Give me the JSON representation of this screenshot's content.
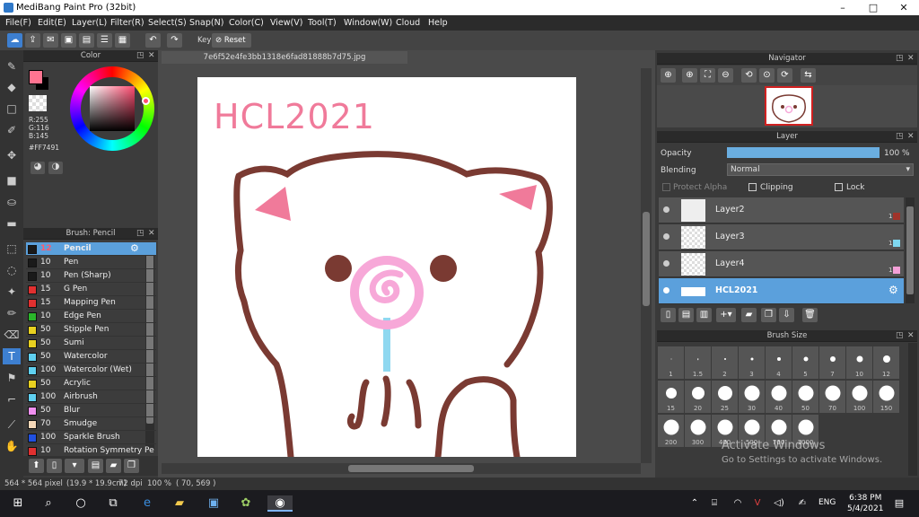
{
  "app": {
    "title": "MediBang Paint Pro (32bit)"
  },
  "window_controls": {
    "minimize": "–",
    "maximize": "□",
    "close": "✕"
  },
  "menu": [
    "File(F)",
    "Edit(E)",
    "Layer(L)",
    "Filter(R)",
    "Select(S)",
    "Snap(N)",
    "Color(C)",
    "View(V)",
    "Tool(T)",
    "Window(W)",
    "Cloud",
    "Help"
  ],
  "toolbar": {
    "key_label": "Key",
    "reset_label": "Reset"
  },
  "color_panel": {
    "title": "Color",
    "r": "R:255",
    "g": "G:116",
    "b": "B:145",
    "hex": "#FF7491",
    "primary": "#FF7491"
  },
  "brush_panel": {
    "title": "Brush: Pencil",
    "items": [
      {
        "size": "12",
        "name": "Pencil",
        "color": "#1a1a1a",
        "selected": true
      },
      {
        "size": "10",
        "name": "Pen",
        "color": "#1a1a1a"
      },
      {
        "size": "10",
        "name": "Pen (Sharp)",
        "color": "#1a1a1a"
      },
      {
        "size": "15",
        "name": "G Pen",
        "color": "#e03030"
      },
      {
        "size": "15",
        "name": "Mapping Pen",
        "color": "#e03030"
      },
      {
        "size": "10",
        "name": "Edge Pen",
        "color": "#2ab52a"
      },
      {
        "size": "50",
        "name": "Stipple Pen",
        "color": "#e8d020"
      },
      {
        "size": "50",
        "name": "Sumi",
        "color": "#e8d020"
      },
      {
        "size": "50",
        "name": "Watercolor",
        "color": "#5fd0f0"
      },
      {
        "size": "100",
        "name": "Watercolor (Wet)",
        "color": "#5fd0f0"
      },
      {
        "size": "50",
        "name": "Acrylic",
        "color": "#e8d020"
      },
      {
        "size": "100",
        "name": "Airbrush",
        "color": "#5fd0f0"
      },
      {
        "size": "50",
        "name": "Blur",
        "color": "#f090f0"
      },
      {
        "size": "70",
        "name": "Smudge",
        "color": "#f5d8b8"
      },
      {
        "size": "100",
        "name": "Sparkle Brush",
        "color": "#2050e0"
      },
      {
        "size": "10",
        "name": "Rotation Symmetry Pe",
        "color": "#e03030"
      }
    ]
  },
  "document": {
    "tab": "7e6f52e4fe3bb1318e6fad81888b7d75.jpg",
    "canvas_text": "HCL2021"
  },
  "navigator": {
    "title": "Navigator"
  },
  "layer_panel": {
    "title": "Layer",
    "opacity_label": "Opacity",
    "opacity_value": "100 %",
    "opacity_fraction": 1.0,
    "blending_label": "Blending",
    "blending_value": "Normal",
    "protect_alpha": "Protect Alpha",
    "clipping": "Clipping",
    "lock": "Lock",
    "layers": [
      {
        "name": "Layer2",
        "badge": "1",
        "badge_color": "#a0332a"
      },
      {
        "name": "Layer3",
        "badge": "1",
        "badge_color": "#7fd8f0"
      },
      {
        "name": "Layer4",
        "badge": "1",
        "badge_color": "#f4a0d8"
      },
      {
        "name": "HCL2021",
        "selected": true
      }
    ]
  },
  "brush_size": {
    "title": "Brush Size",
    "sizes": [
      "1",
      "1.5",
      "2",
      "3",
      "4",
      "5",
      "7",
      "10",
      "12",
      "15",
      "20",
      "25",
      "30",
      "40",
      "50",
      "70",
      "100",
      "150",
      "200",
      "300",
      "400",
      "500",
      "700",
      "1000"
    ]
  },
  "watermark": {
    "line1": "Activate Windows",
    "line2": "Go to Settings to activate Windows."
  },
  "status": {
    "size": "564 * 564 pixel",
    "physical": "(19.9 * 19.9cm)",
    "dpi": "72 dpi",
    "zoom": "100 %",
    "coords": "( 70, 569 )"
  },
  "taskbar": {
    "time": "6:38 PM",
    "date": "5/4/2021",
    "lang": "ENG"
  }
}
